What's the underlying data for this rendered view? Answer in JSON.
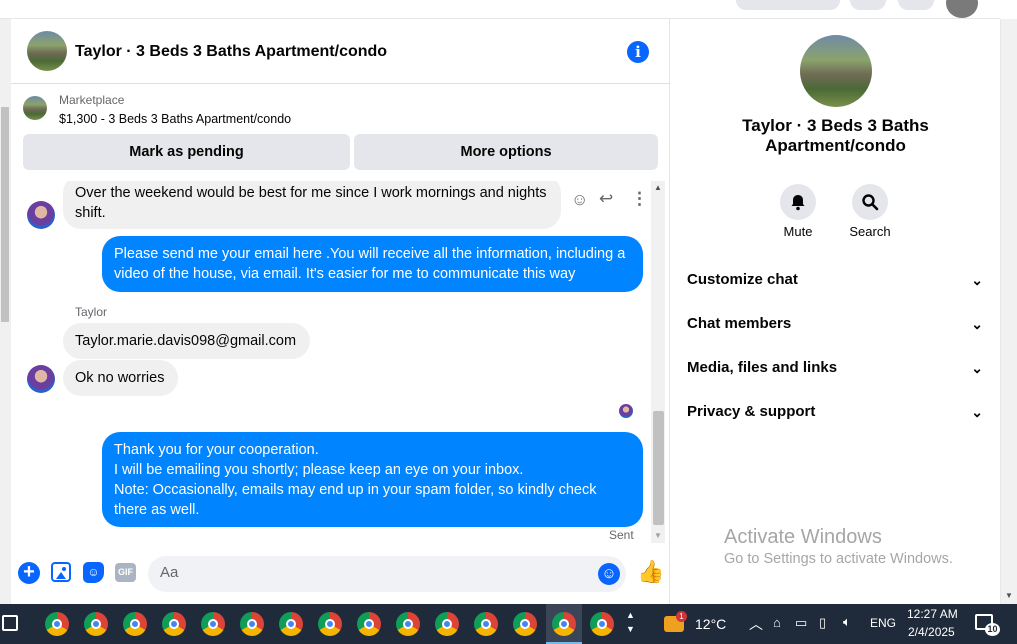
{
  "chat": {
    "title": "Taylor · 3 Beds 3 Baths Apartment/condo",
    "marketplace_label": "Marketplace",
    "listing": "$1,300 - 3 Beds 3 Baths Apartment/condo",
    "mark_pending": "Mark as pending",
    "more_options": "More options",
    "messages": [
      {
        "dir": "in",
        "text": "Over the weekend would be best for me since I work mornings and nights shift."
      },
      {
        "dir": "out",
        "text": "Please send me your email here .You will receive all the information, including a video of the house, via email. It's easier for me to communicate this way"
      },
      {
        "sender": "Taylor"
      },
      {
        "dir": "in",
        "text": "Taylor.marie.davis098@gmail.com"
      },
      {
        "dir": "in",
        "text": "Ok no worries"
      },
      {
        "dir": "out",
        "lines": [
          "Thank you for your cooperation.",
          "I will be emailing you shortly; please keep an eye on your inbox.",
          "Note: Occasionally, emails may end up in your spam folder, so kindly check there as well."
        ]
      }
    ],
    "sent_status": "Sent",
    "composer_placeholder": "Aa",
    "gif_label": "GIF"
  },
  "side": {
    "title": "Taylor · 3 Beds 3 Baths Apartment/condo",
    "mute": "Mute",
    "search": "Search",
    "sections": [
      "Customize chat",
      "Chat members",
      "Media, files and links",
      "Privacy & support"
    ]
  },
  "watermark": {
    "line1": "Activate Windows",
    "line2": "Go to Settings to activate Windows."
  },
  "taskbar": {
    "weather": "12°C",
    "weather_badge": "1",
    "lang": "ENG",
    "time": "12:27 AM",
    "date": "2/4/2025",
    "notifications": "10"
  },
  "colors": {
    "accent": "#0866ff",
    "outgoing_bubble": "#0084ff",
    "incoming_bubble": "#f0f0f0",
    "taskbar": "#1f2a3a"
  },
  "icons": [
    "info-icon",
    "smile-icon",
    "reply-icon",
    "more-icon",
    "plus-icon",
    "image-icon",
    "sticker-icon",
    "gif-icon",
    "emoji-icon",
    "like-icon",
    "bell-icon",
    "search-icon",
    "chevron-down-icon"
  ]
}
